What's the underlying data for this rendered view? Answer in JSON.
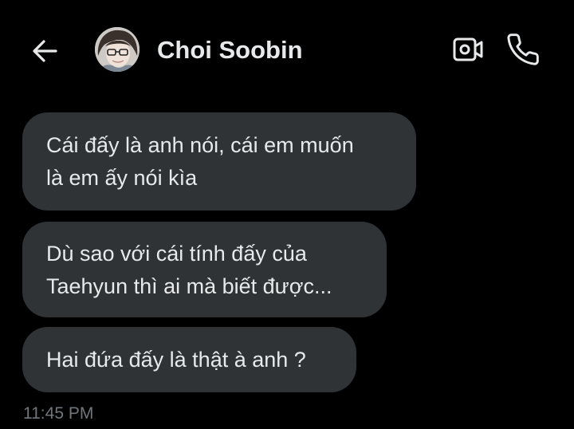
{
  "header": {
    "contact_name": "Choi Soobin",
    "back_icon": "arrow-left-icon",
    "video_icon": "video-camera-icon",
    "call_icon": "phone-icon"
  },
  "messages": [
    {
      "lines": [
        "Cái đấy là anh nói, cái em muốn",
        "là em ấy nói kìa"
      ]
    },
    {
      "lines": [
        "Dù sao với cái tính đấy của",
        "Taehyun thì ai mà biết được..."
      ]
    },
    {
      "lines": [
        "Hai đứa đấy là thật à anh ?"
      ]
    }
  ],
  "timestamp": "11:45 PM",
  "colors": {
    "background": "#000000",
    "bubble": "#2f3336",
    "text": "#e7e9ea",
    "muted_text": "#71767b"
  }
}
